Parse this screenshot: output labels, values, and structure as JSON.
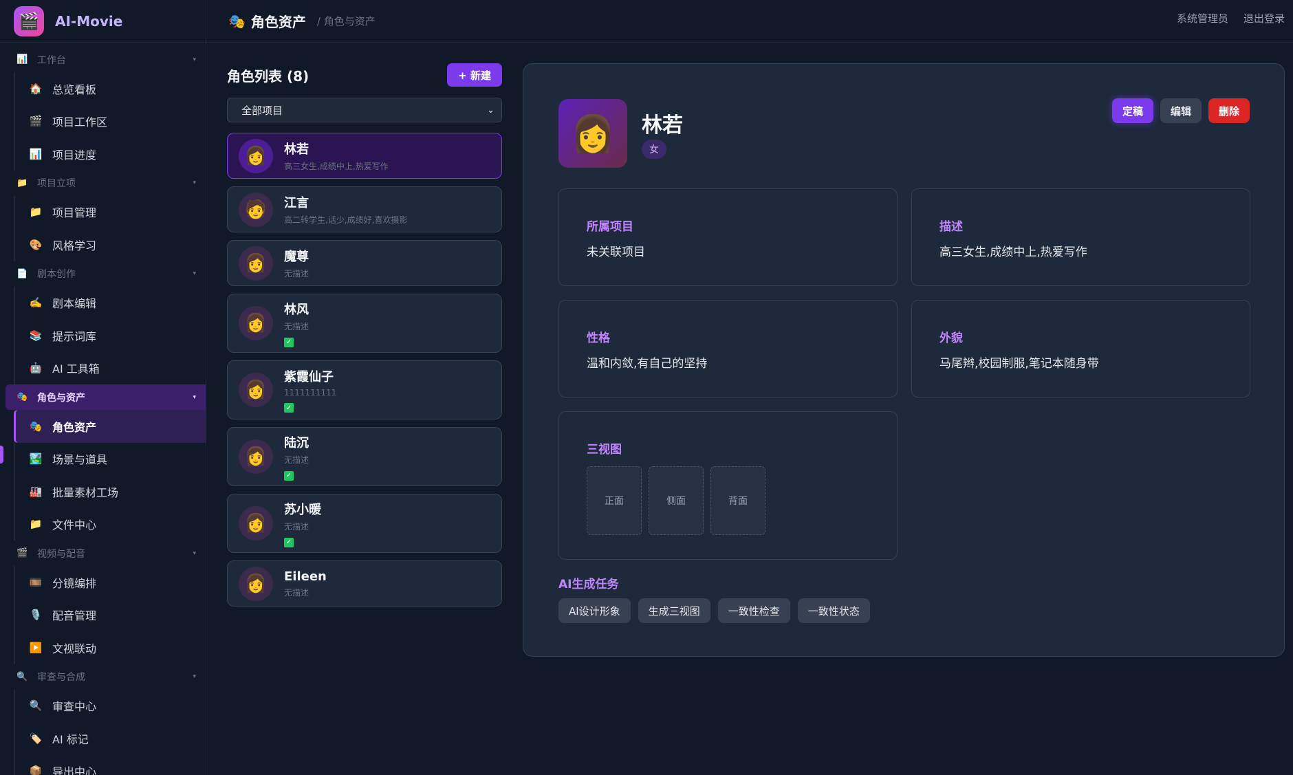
{
  "brand": {
    "logo_icon": "🎬",
    "name": "AI-Movie"
  },
  "topbar": {
    "icon": "🎭",
    "title": "角色资产",
    "breadcrumb": "/ 角色与资产",
    "user": "系统管理员",
    "logout": "退出登录"
  },
  "sidebar": {
    "groups": [
      {
        "icon": "📊",
        "label": "工作台",
        "items": [
          {
            "icon": "🏠",
            "label": "总览看板"
          },
          {
            "icon": "🎬",
            "label": "项目工作区"
          },
          {
            "icon": "📊",
            "label": "项目进度"
          }
        ]
      },
      {
        "icon": "📁",
        "label": "项目立项",
        "items": [
          {
            "icon": "📁",
            "label": "项目管理"
          },
          {
            "icon": "🎨",
            "label": "风格学习"
          }
        ]
      },
      {
        "icon": "📄",
        "label": "剧本创作",
        "items": [
          {
            "icon": "✍️",
            "label": "剧本编辑"
          },
          {
            "icon": "📚",
            "label": "提示词库"
          },
          {
            "icon": "🤖",
            "label": "AI 工具箱"
          }
        ]
      },
      {
        "icon": "🎭",
        "label": "角色与资产",
        "items": [
          {
            "icon": "🎭",
            "label": "角色资产"
          },
          {
            "icon": "🏞️",
            "label": "场景与道具"
          },
          {
            "icon": "🏭",
            "label": "批量素材工场"
          },
          {
            "icon": "📁",
            "label": "文件中心"
          }
        ]
      },
      {
        "icon": "🎬",
        "label": "视频与配音",
        "items": [
          {
            "icon": "🎞️",
            "label": "分镜编排"
          },
          {
            "icon": "🎙️",
            "label": "配音管理"
          },
          {
            "icon": "▶️",
            "label": "文视联动"
          }
        ]
      },
      {
        "icon": "🔍",
        "label": "审查与合成",
        "items": [
          {
            "icon": "🔍",
            "label": "审查中心"
          },
          {
            "icon": "🏷️",
            "label": "AI 标记"
          },
          {
            "icon": "📦",
            "label": "导出中心"
          }
        ]
      }
    ]
  },
  "list": {
    "title": "角色列表 (8)",
    "new_button": "+ 新建",
    "filter_value": "全部项目",
    "characters": [
      {
        "avatar": "👩",
        "name": "林若",
        "desc": "高三女生,成绩中上,热爱写作",
        "done": false
      },
      {
        "avatar": "🧑",
        "name": "江言",
        "desc": "高二转学生,话少,成绩好,喜欢摄影",
        "done": false
      },
      {
        "avatar": "👩",
        "name": "魔尊",
        "desc": "无描述",
        "done": false
      },
      {
        "avatar": "👩",
        "name": "林风",
        "desc": "无描述",
        "done": true
      },
      {
        "avatar": "👩",
        "name": "紫霞仙子",
        "desc": "1111111111",
        "done": true
      },
      {
        "avatar": "👩",
        "name": "陆沉",
        "desc": "无描述",
        "done": true
      },
      {
        "avatar": "👩",
        "name": "苏小暖",
        "desc": "无描述",
        "done": true
      },
      {
        "avatar": "👩",
        "name": "Eileen",
        "desc": "无描述",
        "done": false
      }
    ]
  },
  "detail": {
    "avatar": "👩",
    "name": "林若",
    "gender": "女",
    "actions": {
      "finalize": "定稿",
      "edit": "编辑",
      "delete": "删除"
    },
    "fields": {
      "project_label": "所属项目",
      "project_value": "未关联项目",
      "desc_label": "描述",
      "desc_value": "高三女生,成绩中上,热爱写作",
      "personality_label": "性格",
      "personality_value": "温和内敛,有自己的坚持",
      "appearance_label": "外貌",
      "appearance_value": "马尾辫,校园制服,笔记本随身带"
    },
    "views": {
      "label": "三视图",
      "front": "正面",
      "side": "侧面",
      "back": "背面"
    },
    "ai": {
      "title": "AI生成任务",
      "tasks": [
        "AI设计形象",
        "生成三视图",
        "一致性检查",
        "一致性状态"
      ]
    }
  }
}
